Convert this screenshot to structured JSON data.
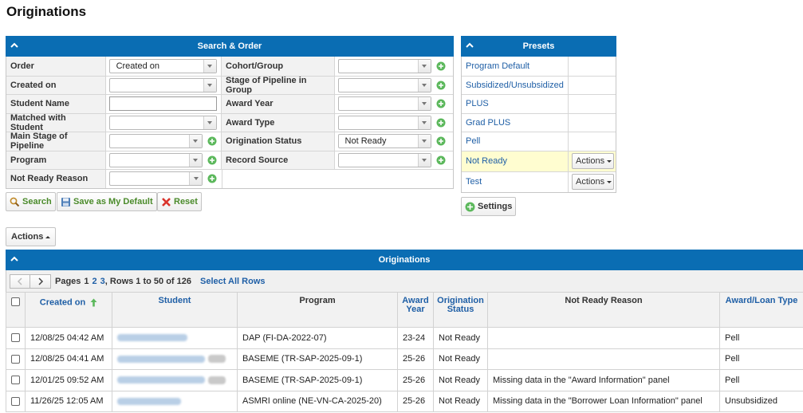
{
  "page": {
    "title": "Originations"
  },
  "search_panel": {
    "title": "Search & Order",
    "left_fields": [
      {
        "label": "Order",
        "value": "Created on"
      },
      {
        "label": "Created on",
        "value": ""
      },
      {
        "label": "Student Name",
        "value": ""
      },
      {
        "label": "Matched with Student",
        "value": ""
      },
      {
        "label": "Main Stage of Pipeline",
        "value": ""
      },
      {
        "label": "Program",
        "value": ""
      },
      {
        "label": "Not Ready Reason",
        "value": ""
      }
    ],
    "right_fields": [
      {
        "label": "Cohort/Group",
        "value": ""
      },
      {
        "label": "Stage of Pipeline in Group",
        "value": ""
      },
      {
        "label": "Award Year",
        "value": ""
      },
      {
        "label": "Award Type",
        "value": ""
      },
      {
        "label": "Origination Status",
        "value": "Not Ready"
      },
      {
        "label": "Record Source",
        "value": ""
      }
    ],
    "buttons": {
      "search": "Search",
      "save_default": "Save as My Default",
      "reset": "Reset"
    }
  },
  "presets_panel": {
    "title": "Presets",
    "items": [
      {
        "label": "Program Default",
        "action": ""
      },
      {
        "label": "Subsidized/Unsubsidized",
        "action": ""
      },
      {
        "label": "PLUS",
        "action": ""
      },
      {
        "label": "Grad PLUS",
        "action": ""
      },
      {
        "label": "Pell",
        "action": ""
      },
      {
        "label": "Not Ready",
        "action": "Actions"
      },
      {
        "label": "Test",
        "action": "Actions"
      }
    ],
    "settings_label": "Settings"
  },
  "actions_button": "Actions",
  "originations": {
    "title": "Originations",
    "pager": {
      "pages_label": "Pages",
      "current_page": "1",
      "page2": "2",
      "page3": "3",
      "rows_text": ", Rows 1 to 50 of 126",
      "select_all": "Select All Rows"
    },
    "columns": {
      "created_on": "Created on",
      "student": "Student",
      "program": "Program",
      "award_year": "Award Year",
      "origination_status": "Origination Status",
      "not_ready_reason": "Not Ready Reason",
      "award_type": "Award/Loan Type"
    },
    "rows": [
      {
        "created_on": "12/08/25 04:42 AM",
        "program": "DAP (FI-DA-2022-07)",
        "award_year": "23-24",
        "status": "Not Ready",
        "reason": "",
        "award_type": "Pell"
      },
      {
        "created_on": "12/08/25 04:41 AM",
        "program": "BASEME (TR-SAP-2025-09-1)",
        "award_year": "25-26",
        "status": "Not Ready",
        "reason": "",
        "award_type": "Pell"
      },
      {
        "created_on": "12/01/25 09:52 AM",
        "program": "BASEME (TR-SAP-2025-09-1)",
        "award_year": "25-26",
        "status": "Not Ready",
        "reason": "Missing data in the \"Award Information\" panel",
        "award_type": "Pell"
      },
      {
        "created_on": "11/26/25 12:05 AM",
        "program": "ASMRI online (NE-VN-CA-2025-20)",
        "award_year": "25-26",
        "status": "Not Ready",
        "reason": "Missing data in the \"Borrower Loan Information\" panel",
        "award_type": "Unsubsidized"
      }
    ]
  },
  "colors": {
    "header_blue": "#0a6db3",
    "link_blue": "#1f5fa6",
    "add_green": "#5cb85c",
    "highlight": "#fffdd0"
  }
}
